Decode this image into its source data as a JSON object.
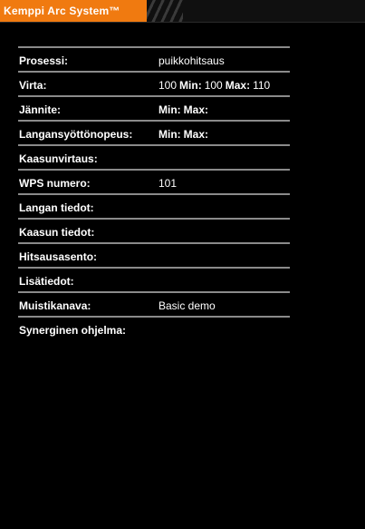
{
  "header": {
    "logo_text": "Kemppi Arc System™"
  },
  "rows": [
    {
      "label": "Prosessi:",
      "value": "puikkohitsaus"
    },
    {
      "label": "Virta:",
      "value": "100",
      "min_label": "Min:",
      "min_value": "100",
      "max_label": "Max:",
      "max_value": "110"
    },
    {
      "label": "Jännite:",
      "min_label": "Min:",
      "max_label": "Max:"
    },
    {
      "label": "Langansyöttönopeus:",
      "min_label": "Min:",
      "max_label": "Max:"
    },
    {
      "label": "Kaasunvirtaus:"
    },
    {
      "label": "WPS numero:",
      "value": "101"
    },
    {
      "label": "Langan tiedot:"
    },
    {
      "label": "Kaasun tiedot:"
    },
    {
      "label": "Hitsausasento:"
    },
    {
      "label": "Lisätiedot:"
    },
    {
      "label": "Muistikanava:",
      "value": "Basic demo"
    },
    {
      "label": "Synerginen ohjelma:"
    }
  ],
  "colors": {
    "background": "#000000",
    "brand_orange": "#f07a10",
    "divider": "#8a8a8a"
  }
}
